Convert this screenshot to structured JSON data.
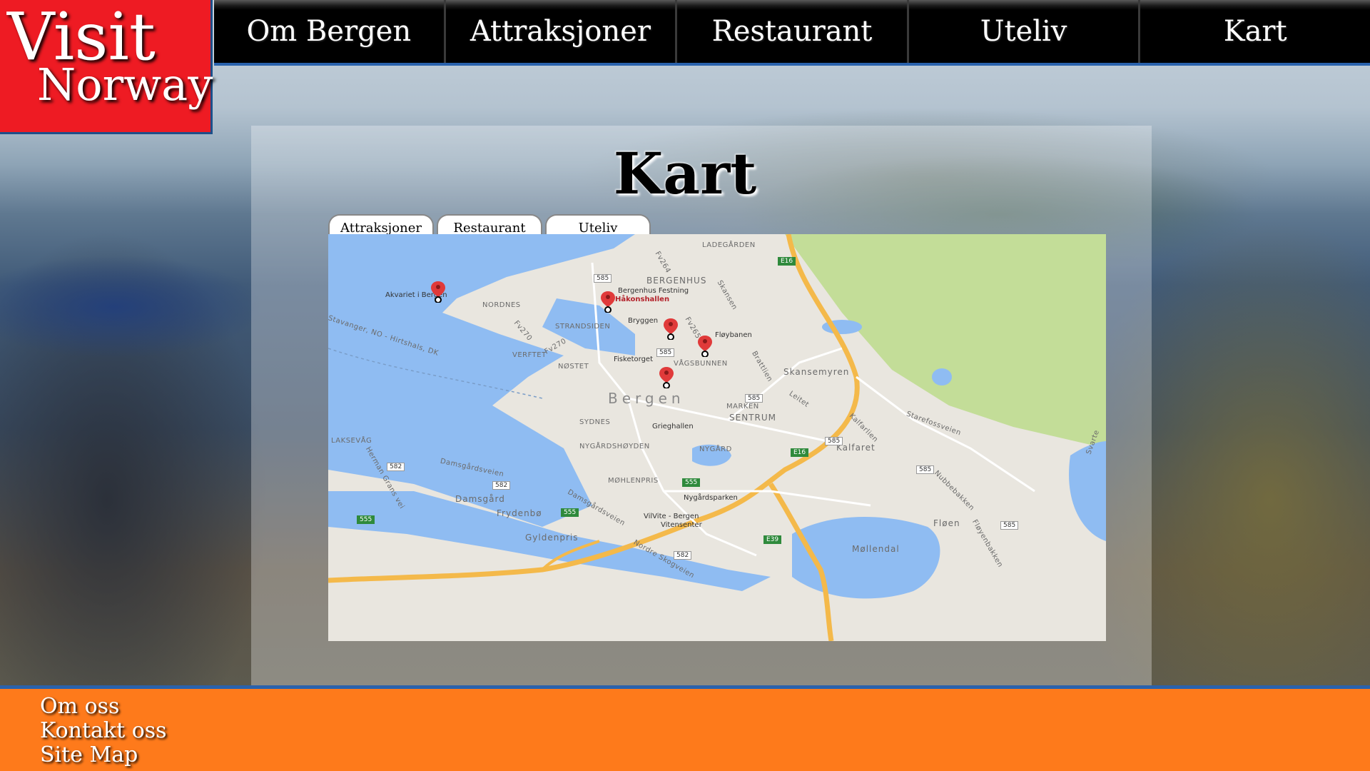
{
  "logo": {
    "line1": "Visit",
    "line2": "Norway"
  },
  "nav": {
    "items": [
      {
        "label": "Om Bergen"
      },
      {
        "label": "Attraksjoner"
      },
      {
        "label": "Restaurant"
      },
      {
        "label": "Uteliv"
      },
      {
        "label": "Kart"
      }
    ]
  },
  "page": {
    "title": "Kart"
  },
  "tabs": [
    {
      "label": "Attraksjoner"
    },
    {
      "label": "Restaurant"
    },
    {
      "label": "Uteliv"
    }
  ],
  "map": {
    "areas": {
      "ladegarden": "LADEGÅRDEN",
      "bergenhus": "BERGENHUS",
      "nordnes": "NORDNES",
      "strandsiden": "STRANDSIDEN",
      "verftet": "VERFTET",
      "nostet": "NØSTET",
      "vagsbunnen": "VÅGSBUNNEN",
      "bergen": "Bergen",
      "sydnes": "SYDNES",
      "marken": "MARKEN",
      "sentrum": "SENTRUM",
      "skansemyren": "Skansemyren",
      "nygardshoyden": "NYGÅRDSHØYDEN",
      "nygard": "NYGÅRD",
      "kalfaret": "Kalfaret",
      "laksevag": "LAKSEVÅG",
      "mohlenpris": "MØHLENPRIS",
      "damsgard": "Damsgård",
      "frydenbo": "Frydenbø",
      "gyldenpris": "Gyldenpris",
      "floen": "Fløen",
      "mollendal": "Møllendal"
    },
    "places": {
      "akvariet": "Akvariet i Bergen",
      "bergenhus_festning": "Bergenhus Festning",
      "hakonshallen": "Håkonshallen",
      "bryggen": "Bryggen",
      "floybanen": "Fløybanen",
      "fisketorget": "Fisketorget",
      "grieghallen": "Grieghallen",
      "nygardsparken": "Nygårdsparken",
      "vilvite": "VilVite - Bergen",
      "vitensenter": "Vitensenter"
    },
    "roads": {
      "stavanger": "Stavanger, NO - Hirtshals, DK",
      "fv264": "Fv264",
      "fv270a": "Fv270",
      "fv270b": "Fv270",
      "fv265": "Fv265",
      "skansen": "Skansen",
      "brattlien": "Brattlien",
      "leitet": "Leitet",
      "kalfarlien": "Kalfarlien",
      "starefossveien": "Starefossveien",
      "nubbebakken": "Nubbebakken",
      "damsgardsveien1": "Damsgårdsveien",
      "damsgardsveien2": "Damsgårdsveien",
      "herman_grans_vei": "Herman Grans vei",
      "nordre_skogveien": "Nordre Skogveien",
      "floyenbakken": "Fløyenbakken",
      "svartediket": "Svarte"
    },
    "shields": {
      "s1": "585",
      "s2": "585",
      "s3": "585",
      "s4": "585",
      "s5": "585",
      "s6": "582",
      "s7": "582",
      "s8": "582",
      "s9": "585",
      "e16a": "E16",
      "e16b": "E16",
      "e39": "E39",
      "r555a": "555",
      "r555b": "555",
      "r555c": "555"
    }
  },
  "footer": {
    "links": [
      {
        "label": "Om oss"
      },
      {
        "label": "Kontakt oss"
      },
      {
        "label": "Site Map"
      }
    ]
  }
}
